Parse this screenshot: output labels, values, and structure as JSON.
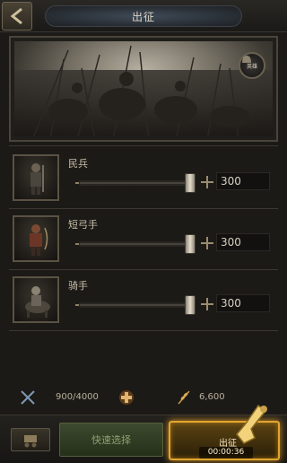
{
  "header": {
    "title": "出征",
    "back_icon": "back-arrow-icon"
  },
  "banner": {
    "badge_label": "英雄"
  },
  "troops": [
    {
      "name": "民兵",
      "count": "300",
      "ratio": 1.0,
      "icon": "militia-icon"
    },
    {
      "name": "短弓手",
      "count": "300",
      "ratio": 1.0,
      "icon": "archer-icon"
    },
    {
      "name": "骑手",
      "count": "300",
      "ratio": 1.0,
      "icon": "rider-icon"
    }
  ],
  "resources": {
    "troops_capacity": "900/4000",
    "food": "6,600"
  },
  "footer": {
    "quick_select_label": "快速选择",
    "march_label": "出征",
    "march_time": "00:00:36"
  },
  "colors": {
    "accent_gold": "#e0a630",
    "quick_green": "#3d4a2f",
    "background": "#1c1a17"
  }
}
